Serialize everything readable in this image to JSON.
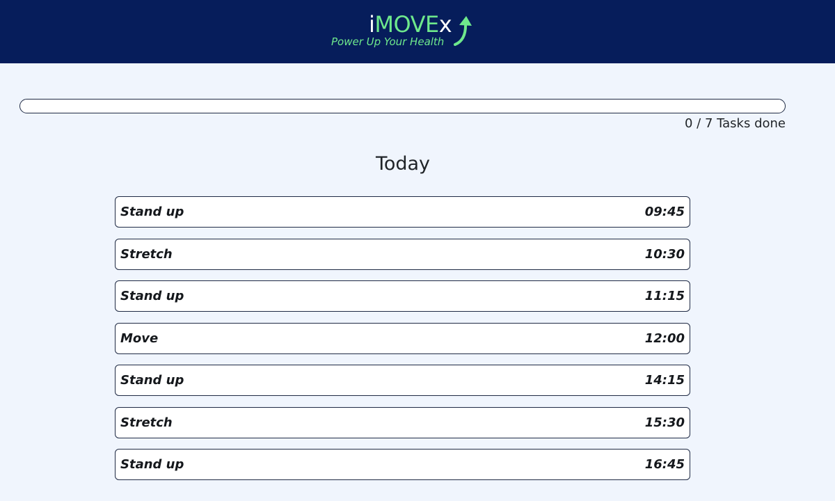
{
  "brand": {
    "logo_i": "i",
    "logo_move": "MOVE",
    "logo_x": "x",
    "tagline": "Power Up Your Health",
    "arrow_icon": "arrow-up-icon",
    "colors": {
      "header_bg": "#061d5b",
      "accent": "#6ee88c",
      "page_bg": "#f0f5fd"
    }
  },
  "progress": {
    "done": 0,
    "total": 7,
    "fraction": 0,
    "label": "0 / 7 Tasks done"
  },
  "section": {
    "title": "Today"
  },
  "tasks": [
    {
      "name": "Stand up",
      "time": "09:45"
    },
    {
      "name": "Stretch",
      "time": "10:30"
    },
    {
      "name": "Stand up",
      "time": "11:15"
    },
    {
      "name": "Move",
      "time": "12:00"
    },
    {
      "name": "Stand up",
      "time": "14:15"
    },
    {
      "name": "Stretch",
      "time": "15:30"
    },
    {
      "name": "Stand up",
      "time": "16:45"
    }
  ]
}
